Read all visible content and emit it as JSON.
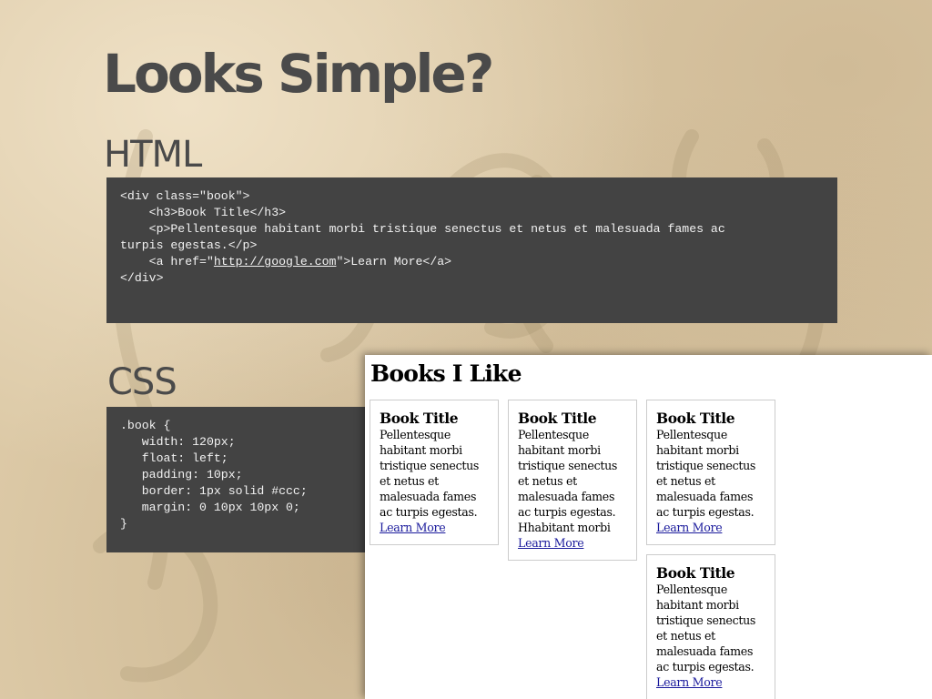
{
  "slide": {
    "title": "Looks Simple?",
    "html_heading": "HTML",
    "css_heading": "CSS"
  },
  "html_code": {
    "line1": "<div class=\"book\">",
    "line2": "    <h3>Book Title</h3>",
    "line3": "    <p>Pellentesque habitant morbi tristique senectus et netus et malesuada fames ac",
    "line4": "turpis egestas.</p>",
    "line5_before": "    <a href=\"",
    "line5_link": "http://google.com",
    "line5_after": "\">Learn More</a>",
    "line6": "</div>"
  },
  "css_code": {
    "line1": ".book {",
    "line2": "   width: 120px;",
    "line3": "   float: left;",
    "line4": "   padding: 10px;",
    "line5": "   border: 1px solid #ccc;",
    "line6": "   margin: 0 10px 10px 0;",
    "line7": "}"
  },
  "demo": {
    "heading": "Books I Like",
    "books": [
      {
        "title": "Book Title",
        "text": "Pellentesque habitant morbi tristique senectus et netus et malesuada fames ac turpis egestas.",
        "link": "Learn More"
      },
      {
        "title": "Book Title",
        "text": "Pellentesque habitant morbi tristique senectus et netus et malesuada fames ac turpis egestas. Hhabitant morbi",
        "link": "Learn More"
      },
      {
        "title": "Book Title",
        "text": "Pellentesque habitant morbi tristique senectus et netus et malesuada fames ac turpis egestas.",
        "link": "Learn More"
      },
      {
        "title": "Book Title",
        "text": "Pellentesque habitant morbi tristique senectus et netus et malesuada fames ac turpis egestas.",
        "link": "Learn More"
      }
    ]
  },
  "colors": {
    "background": "#dcc9a6",
    "code_background": "#434343",
    "heading_text": "#4a4a4a",
    "link": "#1a1a9c",
    "book_border": "#cccccc"
  }
}
